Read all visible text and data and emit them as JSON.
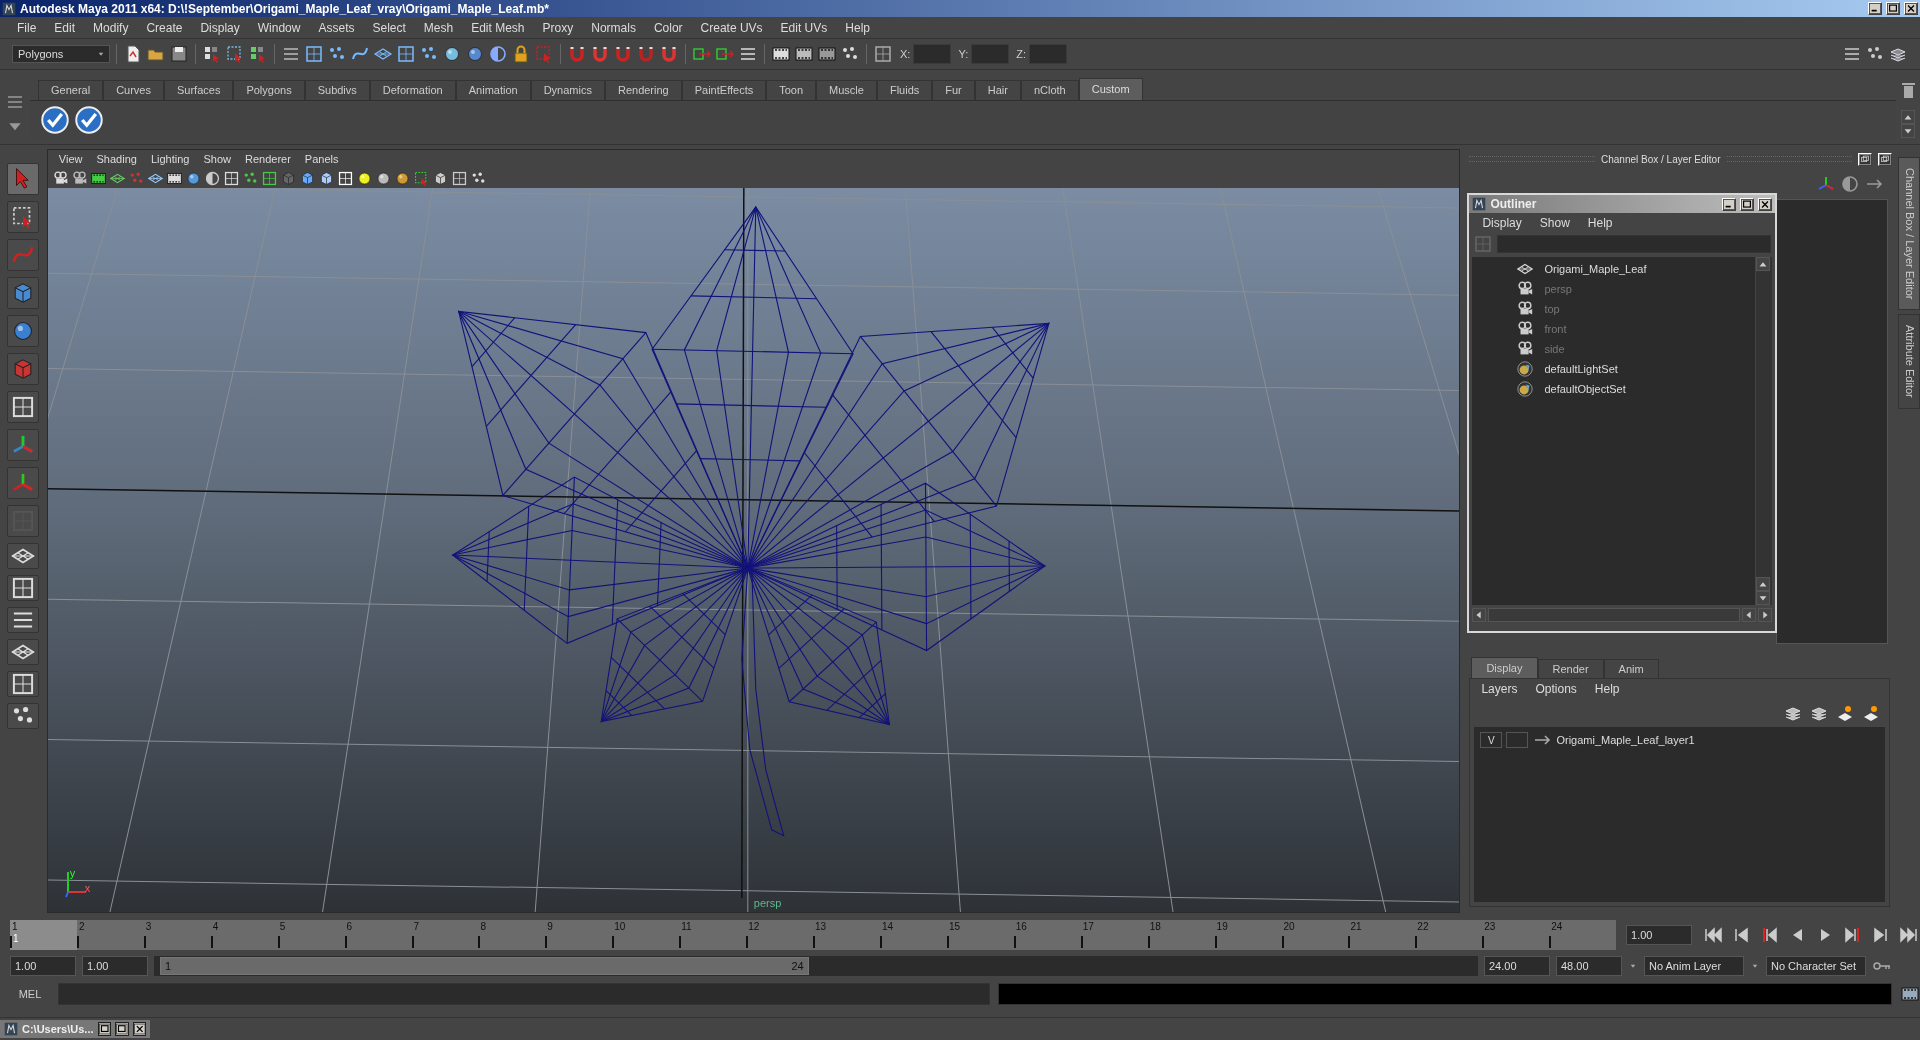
{
  "window": {
    "title": "Autodesk Maya 2011 x64: D:\\!September\\Origami_Maple_Leaf_vray\\Origami_Maple_Leaf.mb*"
  },
  "menu": [
    "File",
    "Edit",
    "Modify",
    "Create",
    "Display",
    "Window",
    "Assets",
    "Select",
    "Mesh",
    "Edit Mesh",
    "Proxy",
    "Normals",
    "Color",
    "Create UVs",
    "Edit UVs",
    "Help"
  ],
  "status_line": {
    "mode": "Polygons",
    "coords": [
      "X:",
      "Y:",
      "Z:"
    ]
  },
  "shelf": {
    "tabs": [
      {
        "label": "General",
        "selected": false
      },
      {
        "label": "Curves",
        "selected": false
      },
      {
        "label": "Surfaces",
        "selected": false
      },
      {
        "label": "Polygons",
        "selected": false
      },
      {
        "label": "Subdivs",
        "selected": false
      },
      {
        "label": "Deformation",
        "selected": false
      },
      {
        "label": "Animation",
        "selected": false
      },
      {
        "label": "Dynamics",
        "selected": false
      },
      {
        "label": "Rendering",
        "selected": false
      },
      {
        "label": "PaintEffects",
        "selected": false
      },
      {
        "label": "Toon",
        "selected": false
      },
      {
        "label": "Muscle",
        "selected": false
      },
      {
        "label": "Fluids",
        "selected": false
      },
      {
        "label": "Fur",
        "selected": false
      },
      {
        "label": "Hair",
        "selected": false
      },
      {
        "label": "nCloth",
        "selected": false
      },
      {
        "label": "Custom",
        "selected": true
      }
    ]
  },
  "viewport": {
    "menu": [
      "View",
      "Shading",
      "Lighting",
      "Show",
      "Renderer",
      "Panels"
    ],
    "axis_labels": [
      "y",
      "x"
    ],
    "camera": "persp"
  },
  "channel_box": {
    "title": "Channel Box / Layer Editor"
  },
  "outliner": {
    "title": "Outliner",
    "menu": [
      "Display",
      "Show",
      "Help"
    ],
    "items": [
      {
        "label": "Origami_Maple_Leaf",
        "kind": "mesh",
        "dimmed": false
      },
      {
        "label": "persp",
        "kind": "camera",
        "dimmed": true
      },
      {
        "label": "top",
        "kind": "camera",
        "dimmed": true
      },
      {
        "label": "front",
        "kind": "camera",
        "dimmed": true
      },
      {
        "label": "side",
        "kind": "camera",
        "dimmed": true
      },
      {
        "label": "defaultLightSet",
        "kind": "set",
        "dimmed": false
      },
      {
        "label": "defaultObjectSet",
        "kind": "set",
        "dimmed": false
      }
    ]
  },
  "layer_editor": {
    "tabs": [
      {
        "label": "Display",
        "selected": true
      },
      {
        "label": "Render",
        "selected": false
      },
      {
        "label": "Anim",
        "selected": false
      }
    ],
    "menu": [
      "Layers",
      "Options",
      "Help"
    ],
    "layers": [
      {
        "visibility": "V",
        "name": "Origami_Maple_Leaf_layer1"
      }
    ]
  },
  "side_tabs": [
    {
      "label": "Channel Box / Layer Editor",
      "selected": true
    },
    {
      "label": "Attribute Editor",
      "selected": false
    }
  ],
  "timeline": {
    "ticks": [
      {
        "label": "1",
        "selected": true
      },
      {
        "label": "2",
        "selected": false
      },
      {
        "label": "3",
        "selected": false
      },
      {
        "label": "4",
        "selected": false
      },
      {
        "label": "5",
        "selected": false
      },
      {
        "label": "6",
        "selected": false
      },
      {
        "label": "7",
        "selected": false
      },
      {
        "label": "8",
        "selected": false
      },
      {
        "label": "9",
        "selected": false
      },
      {
        "label": "10",
        "selected": false
      },
      {
        "label": "11",
        "selected": false
      },
      {
        "label": "12",
        "selected": false
      },
      {
        "label": "13",
        "selected": false
      },
      {
        "label": "14",
        "selected": false
      },
      {
        "label": "15",
        "selected": false
      },
      {
        "label": "16",
        "selected": false
      },
      {
        "label": "17",
        "selected": false
      },
      {
        "label": "18",
        "selected": false
      },
      {
        "label": "19",
        "selected": false
      },
      {
        "label": "20",
        "selected": false
      },
      {
        "label": "21",
        "selected": false
      },
      {
        "label": "22",
        "selected": false
      },
      {
        "label": "23",
        "selected": false
      },
      {
        "label": "24",
        "selected": false
      }
    ],
    "current": "1",
    "current_time": "1.00"
  },
  "range": {
    "level": 0.49,
    "start": "1.00",
    "playback_start": "1.00",
    "slider_start": "1",
    "slider_end": "24",
    "playback_end": "24.00",
    "end": "48.00",
    "anim_layer": "No Anim Layer",
    "character_set": "No Character Set"
  },
  "command_line": {
    "label": "MEL"
  },
  "taskbar": {
    "title": "C:\\Users\\Us..."
  }
}
